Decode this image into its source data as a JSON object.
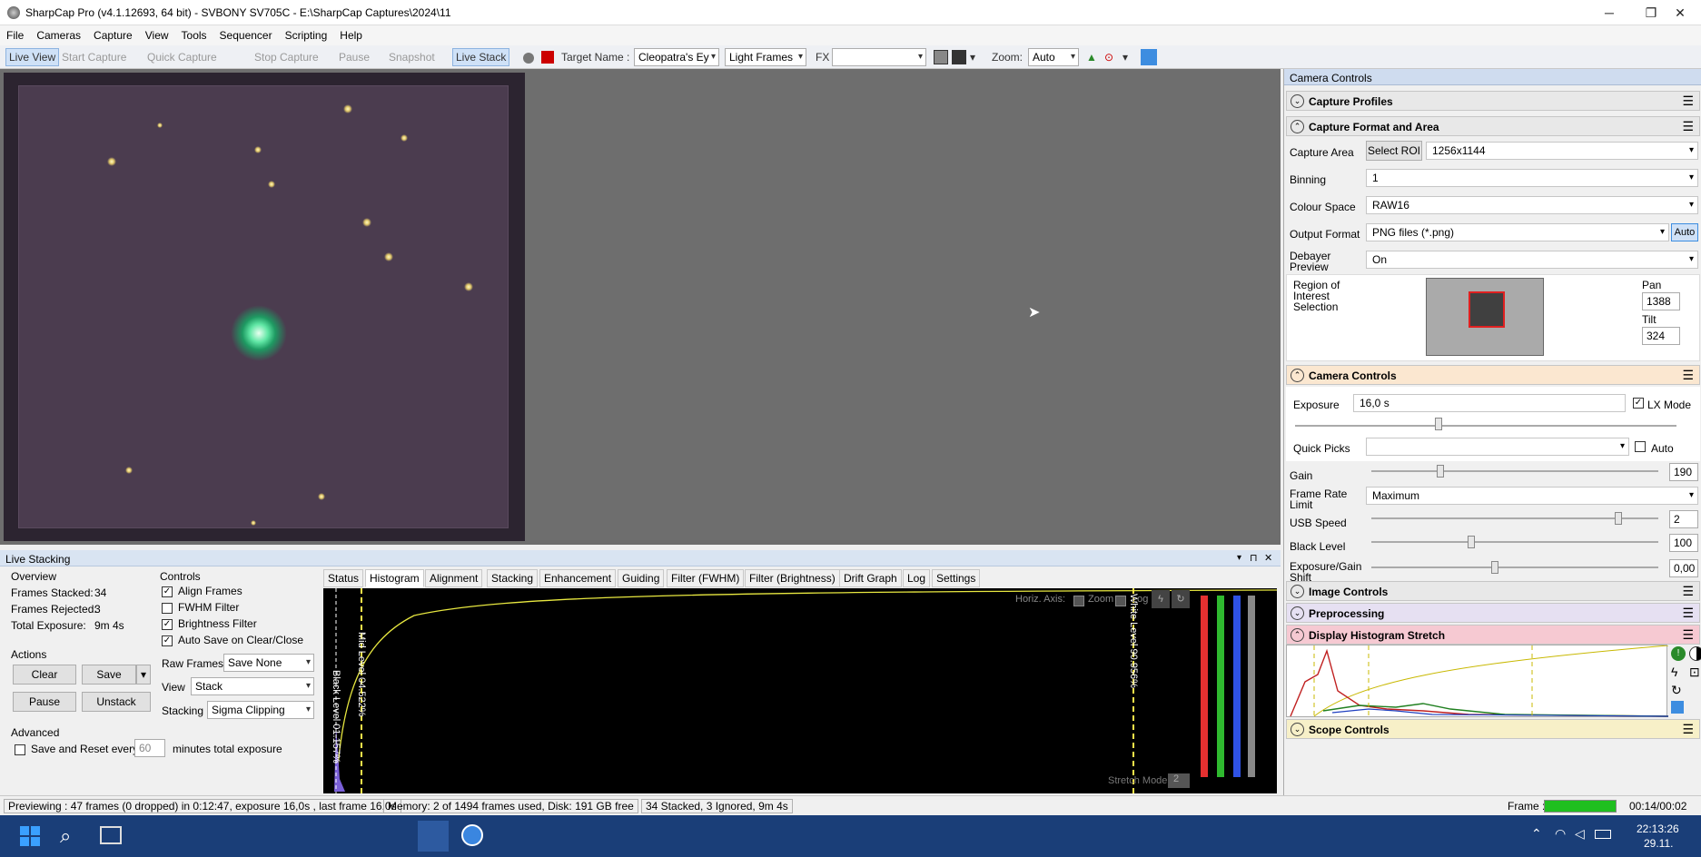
{
  "window": {
    "title": "SharpCap Pro (v4.1.12693, 64 bit) - SVBONY SV705C - E:\\SharpCap Captures\\2024\\11",
    "minimize": "─",
    "restore": "❐",
    "close": "✕"
  },
  "menu": [
    "File",
    "Cameras",
    "Capture",
    "View",
    "Tools",
    "Sequencer",
    "Scripting",
    "Help"
  ],
  "toolbar": {
    "live_view": "Live View",
    "start_capture": "Start Capture",
    "quick_capture": "Quick Capture",
    "stop_capture": "Stop Capture",
    "pause": "Pause",
    "snapshot": "Snapshot",
    "live_stack": "Live Stack",
    "target_name_label": "Target Name :",
    "target_name_value": "Cleopatra's Ey",
    "frame_type": "Light Frames",
    "fx_label": "FX",
    "fx_value": "",
    "zoom_label": "Zoom:",
    "zoom_value": "Auto"
  },
  "live_stacking": {
    "header": "Live Stacking",
    "overview": {
      "title": "Overview",
      "frames_stacked_label": "Frames Stacked:",
      "frames_stacked": "34",
      "frames_rejected_label": "Frames Rejected:",
      "frames_rejected": "3",
      "total_exposure_label": "Total Exposure:",
      "total_exposure": "9m 4s"
    },
    "actions": {
      "title": "Actions",
      "clear": "Clear",
      "save": "Save",
      "pause": "Pause",
      "unstack": "Unstack"
    },
    "advanced": {
      "title": "Advanced",
      "save_reset_label": "Save and Reset every",
      "save_reset_value": "60",
      "save_reset_suffix": "minutes total exposure"
    },
    "controls": {
      "title": "Controls",
      "align_frames": "Align Frames",
      "fwhm_filter": "FWHM Filter",
      "brightness_filter": "Brightness Filter",
      "auto_save": "Auto Save on Clear/Close",
      "raw_frames_label": "Raw Frames",
      "raw_frames_value": "Save None",
      "view_label": "View",
      "view_value": "Stack",
      "stacking_label": "Stacking",
      "stacking_value": "Sigma Clipping"
    },
    "tabs": [
      "Status",
      "Histogram",
      "Alignment",
      "Stacking",
      "Enhancement",
      "Guiding",
      "Filter (FWHM)",
      "Filter (Brightness)",
      "Drift Graph",
      "Log",
      "Settings"
    ],
    "histogram": {
      "horiz_axis_label": "Horiz. Axis:",
      "zoom_label": "Zoom",
      "log_label": "Log",
      "black_level": "Black Level 01.157%",
      "mid_level": "Mid Level 04.522%",
      "white_level": "White Level 90.956%",
      "stretch_mode_label": "Stretch Mode",
      "stretch_mode_value": "2"
    }
  },
  "camera_panel": {
    "header": "Camera Controls",
    "sections": {
      "capture_profiles": "Capture Profiles",
      "capture_format": "Capture Format and Area",
      "camera_controls": "Camera Controls",
      "image_controls": "Image Controls",
      "preprocessing": "Preprocessing",
      "display_histogram": "Display Histogram Stretch",
      "scope_controls": "Scope Controls"
    },
    "capture_area_label": "Capture Area",
    "select_roi": "Select ROI",
    "capture_area_value": "1256x1144",
    "binning_label": "Binning",
    "binning_value": "1",
    "colour_space_label": "Colour Space",
    "colour_space_value": "RAW16",
    "output_format_label": "Output Format",
    "output_format_value": "PNG files (*.png)",
    "output_auto": "Auto",
    "debayer_label": "Debayer Preview",
    "debayer_value": "On",
    "roi_label": "Region of Interest Selection",
    "pan_label": "Pan",
    "pan_value": "1388",
    "tilt_label": "Tilt",
    "tilt_value": "324",
    "exposure_label": "Exposure",
    "exposure_value": "16,0 s",
    "lx_mode": "LX Mode",
    "quick_picks_label": "Quick Picks",
    "quick_picks_auto": "Auto",
    "gain_label": "Gain",
    "gain_value": "190",
    "frame_rate_label": "Frame Rate Limit",
    "frame_rate_value": "Maximum",
    "usb_speed_label": "USB Speed",
    "usb_speed_value": "2",
    "black_level_label": "Black Level",
    "black_level_value": "100",
    "exposure_gain_shift_label": "Exposure/Gain Shift",
    "exposure_gain_shift_value": "0,00"
  },
  "status": {
    "previewing": "Previewing : 47 frames (0 dropped) in 0:12:47, exposure 16,0s , last frame 16,0s",
    "memory": "Memory: 2 of 1494 frames used, Disk: 191 GB free",
    "stack": "34 Stacked, 3 Ignored, 9m 4s",
    "frame_label": "Frame :",
    "frame_time": "00:14/00:02"
  },
  "taskbar": {
    "time": "22:13:26",
    "date": "29.11."
  }
}
